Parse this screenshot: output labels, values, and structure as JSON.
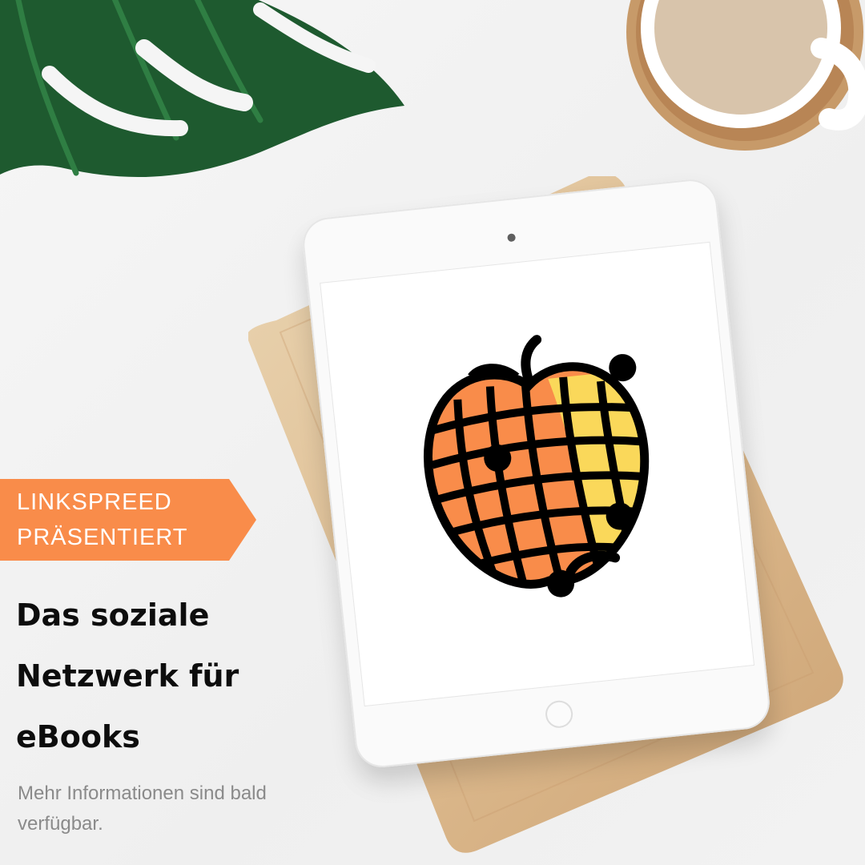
{
  "ribbon": {
    "line1": "LINKSPREED",
    "line2": "PRÄSENTIERT",
    "color": "#F98C4A"
  },
  "headline": {
    "line1": "Das soziale",
    "line2": "Netzwerk für",
    "line3": "eBooks"
  },
  "subtext": "Mehr Informationen sind bald verfügbar.",
  "tablet_logo": {
    "icon": "apple-network-logo-icon",
    "colors": {
      "orange": "#F98C4A",
      "yellow": "#FAD85A",
      "outline": "#000000"
    }
  },
  "scene_objects": {
    "leaf": "monstera-leaf-icon",
    "coffee": "coffee-cup-icon",
    "notebook": "notebook-icon"
  }
}
